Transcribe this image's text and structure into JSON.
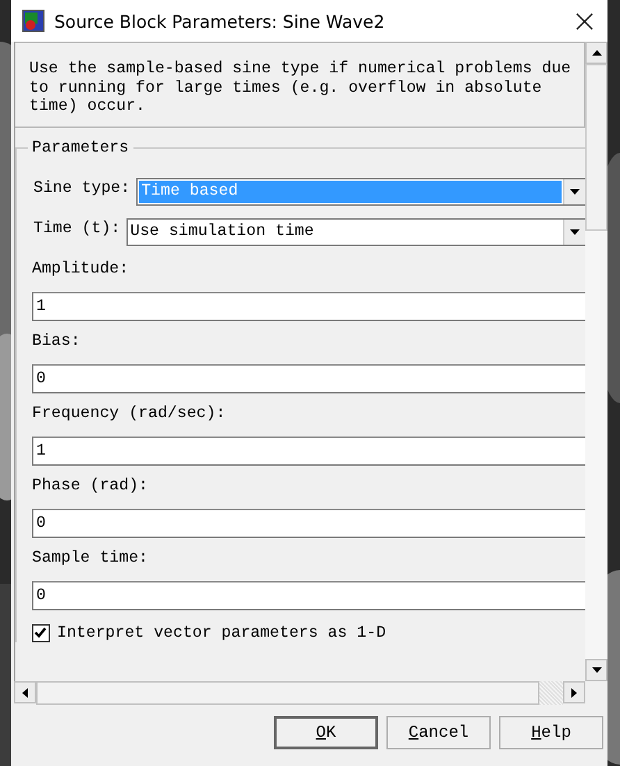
{
  "window": {
    "title": "Source Block Parameters: Sine Wave2"
  },
  "description": "Use the sample-based sine type if numerical problems due to running for large times (e.g. overflow in absolute time) occur.",
  "parameters": {
    "title": "Parameters",
    "fields": [
      {
        "kind": "dropdown",
        "label": "Sine type:",
        "value": "Time based",
        "selected": true
      },
      {
        "kind": "dropdown",
        "label": "Time (t):",
        "value": "Use simulation time",
        "selected": false
      },
      {
        "kind": "text",
        "label": "Amplitude:",
        "value": "1"
      },
      {
        "kind": "text",
        "label": "Bias:",
        "value": "0"
      },
      {
        "kind": "text",
        "label": "Frequency (rad/sec):",
        "value": "1"
      },
      {
        "kind": "text",
        "label": "Phase (rad):",
        "value": "0"
      },
      {
        "kind": "text",
        "label": "Sample time:",
        "value": "0"
      },
      {
        "kind": "checkbox",
        "label": "Interpret vector parameters as 1-D",
        "checked": true
      }
    ]
  },
  "buttons": [
    {
      "label": "OK",
      "default": true
    },
    {
      "label": "Cancel",
      "default": false
    },
    {
      "label": "Help",
      "default": false
    }
  ]
}
